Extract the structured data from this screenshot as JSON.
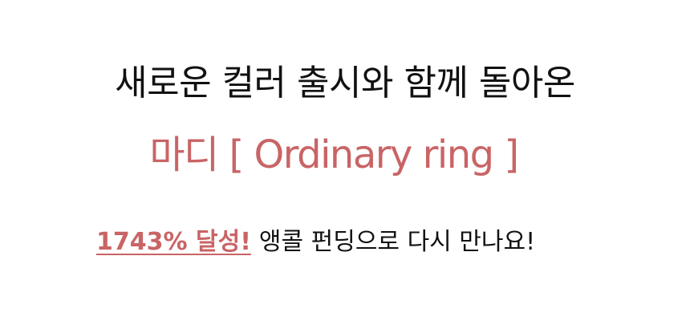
{
  "banner": {
    "headline": "새로운 컬러 출시와 함께 돌아온",
    "subheadline": "마디 [ Ordinary ring ]",
    "highlight": "1743% 달성!",
    "tagline_rest": "앵콜 펀딩으로 다시 만나요!"
  },
  "colors": {
    "text": "#111111",
    "accent": "#c96465"
  }
}
